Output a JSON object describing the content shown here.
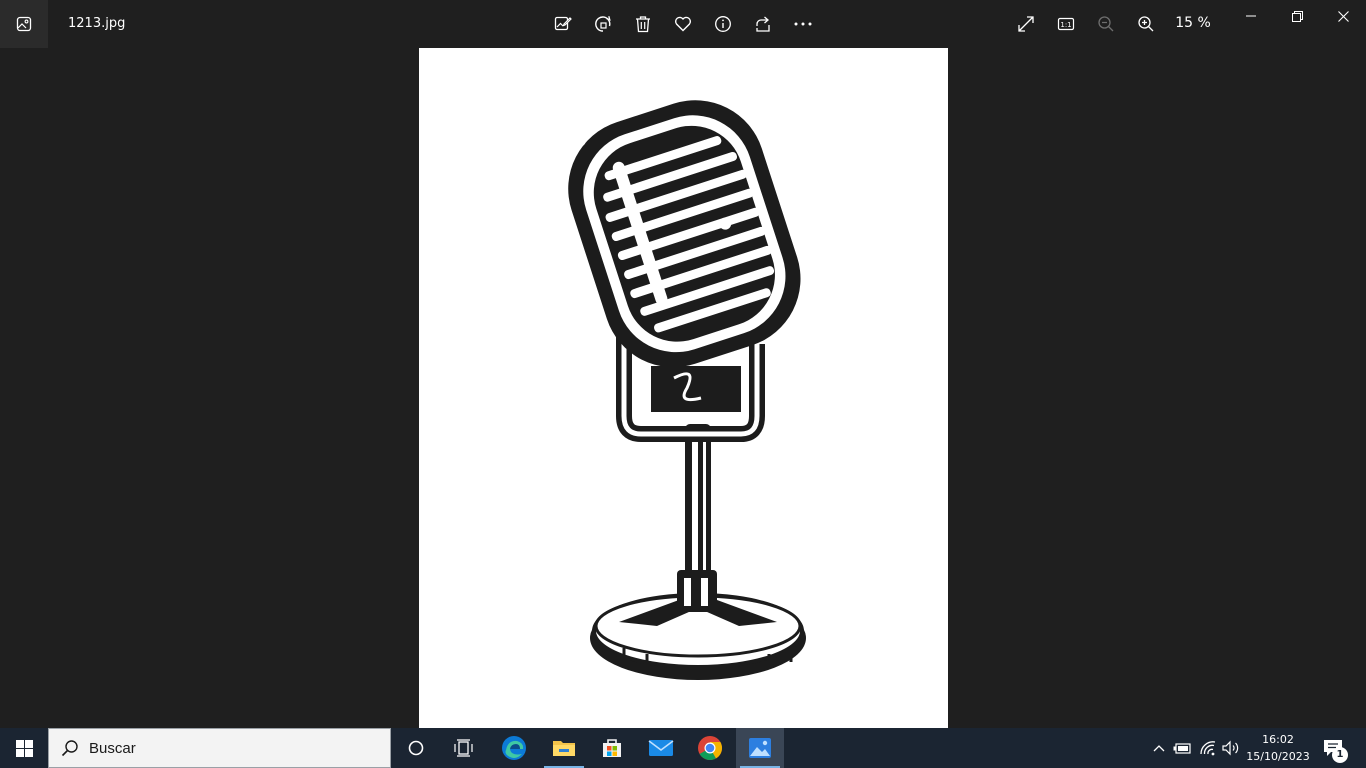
{
  "window": {
    "file_name": "1213.jpg",
    "zoom_level": "15 %"
  },
  "toolbar": {
    "icons": [
      "edit-image-icon",
      "rotate-icon",
      "delete-icon",
      "favorite-icon",
      "info-icon",
      "share-icon",
      "more-icon"
    ],
    "right_icons": [
      "fullscreen-icon",
      "actual-size-icon",
      "zoom-out-icon",
      "zoom-in-icon"
    ]
  },
  "window_controls": [
    "minimize-icon",
    "restore-icon",
    "close-icon"
  ],
  "taskbar": {
    "search_placeholder": "Buscar",
    "pinned_apps": [
      "cortana",
      "task-view",
      "edge",
      "file-explorer",
      "microsoft-store",
      "mail",
      "chrome",
      "photos"
    ],
    "clock": {
      "time": "16:02",
      "date": "15/10/2023"
    },
    "notification_count": "1"
  },
  "colors": {
    "background": "#1f1f1f",
    "taskbar": "#1b2532",
    "accent": "#78b4e6"
  }
}
